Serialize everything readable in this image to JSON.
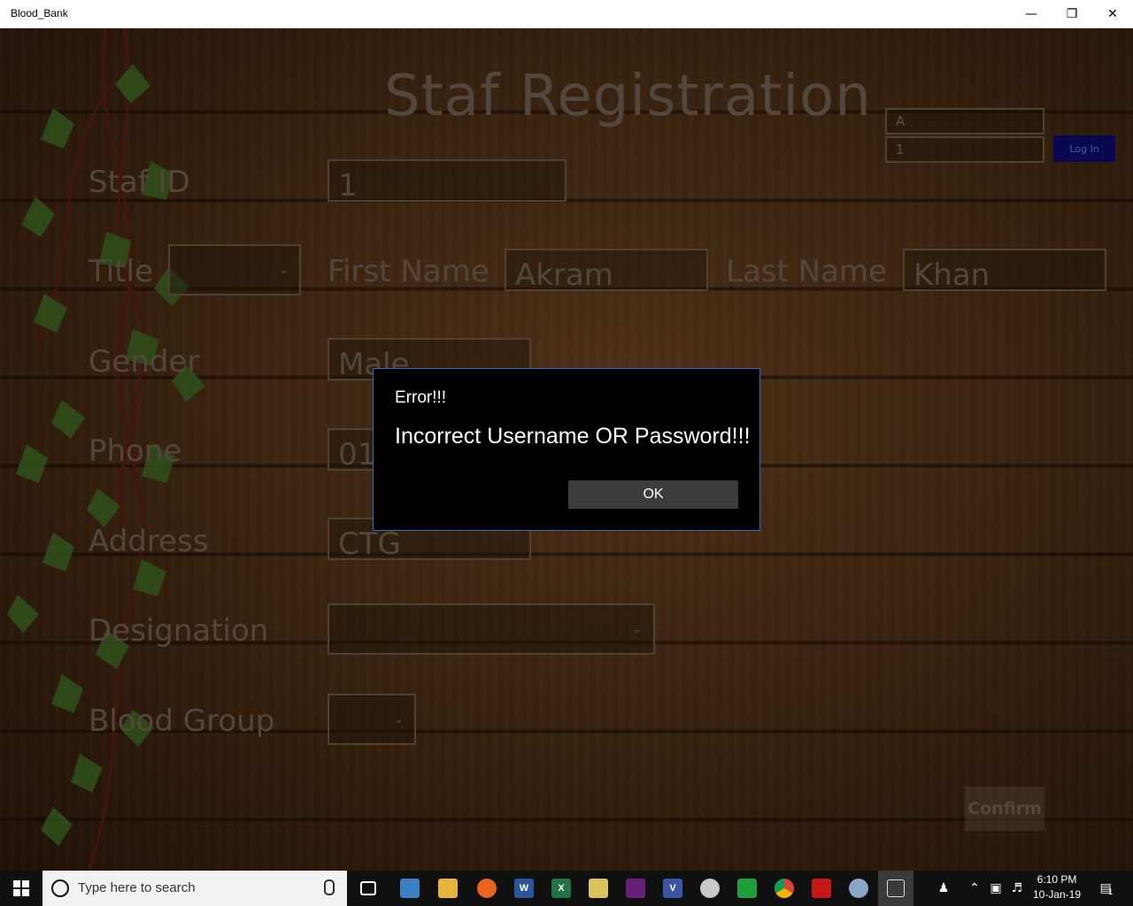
{
  "window": {
    "title": "Blood_Bank",
    "minimize_glyph": "—",
    "restore_glyph": "❐",
    "close_glyph": "✕"
  },
  "form": {
    "heading": "Staf Registration",
    "login": {
      "username_value": "A",
      "password_value": "1",
      "button_label": "Log In"
    },
    "labels": {
      "staf_id": "Staf ID",
      "title": "Title",
      "first_name": "First Name",
      "last_name": "Last Name",
      "gender": "Gender",
      "phone": "Phone",
      "address": "Address",
      "designation": "Designation",
      "blood_group": "Blood Group"
    },
    "values": {
      "staf_id": "1",
      "title": "",
      "first_name": "Akram",
      "last_name": "Khan",
      "gender": "Male",
      "phone": "01",
      "address": "CTG",
      "designation": "",
      "blood_group": ""
    },
    "confirm_label": "Confirm"
  },
  "dialog": {
    "title": "Error!!!",
    "message": "Incorrect Username OR Password!!!",
    "ok_label": "OK"
  },
  "taskbar": {
    "search_placeholder": "Type here to search",
    "clock_time": "6:10 PM",
    "clock_date": "10-Jan-19",
    "notification_count": "1",
    "apps": [
      "task-view",
      "file-manager",
      "file-explorer",
      "firefox",
      "word",
      "excel",
      "access-tool",
      "visual-studio",
      "visio",
      "paint",
      "eye-app",
      "chrome",
      "acrobat",
      "paint-brush",
      "active-app"
    ]
  },
  "colors": {
    "dialog_border": "#2a6fc7",
    "login_button": "#0d0b6b",
    "label_text": "#6f5e50"
  }
}
